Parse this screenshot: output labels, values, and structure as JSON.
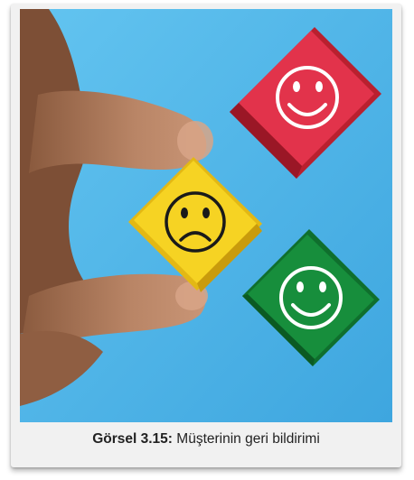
{
  "caption": {
    "label": "Görsel 3.15:",
    "text": "Müşterinin geri bildirimi"
  },
  "colors": {
    "background": "#4fb3e8",
    "red_cube": "#e2334b",
    "yellow_cube": "#f6d323",
    "green_cube": "#178e3c",
    "skin": "#b98566"
  },
  "icons": [
    "smiley-happy-icon",
    "smiley-sad-icon",
    "smiley-happy-icon"
  ]
}
